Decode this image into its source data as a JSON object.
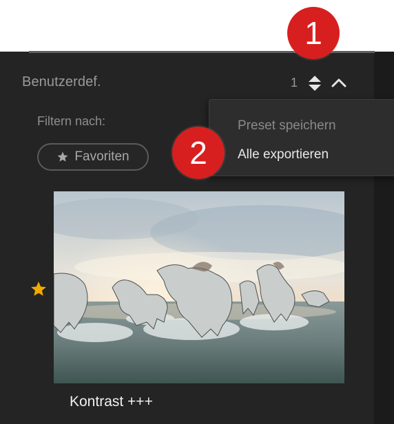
{
  "panel": {
    "section_title": "Benutzerdef.",
    "count": "1",
    "filter_label": "Filtern nach:",
    "favorites_button": "Favoriten"
  },
  "dropdown": {
    "items": [
      {
        "label": "Preset speichern",
        "enabled": false
      },
      {
        "label": "Alle exportieren",
        "enabled": true
      }
    ]
  },
  "badges": [
    "1",
    "2"
  ],
  "preset": {
    "name": "Kontrast +++",
    "favorite": true,
    "thumbnail_icon": "horses-photo"
  },
  "icons": {
    "sort": "sort-updown-icon",
    "collapse": "chevron-up-icon",
    "favorite": "star-icon"
  },
  "colors": {
    "panel_bg": "#242424",
    "badge_red": "#d81f1f",
    "star_gold": "#f2a900"
  }
}
